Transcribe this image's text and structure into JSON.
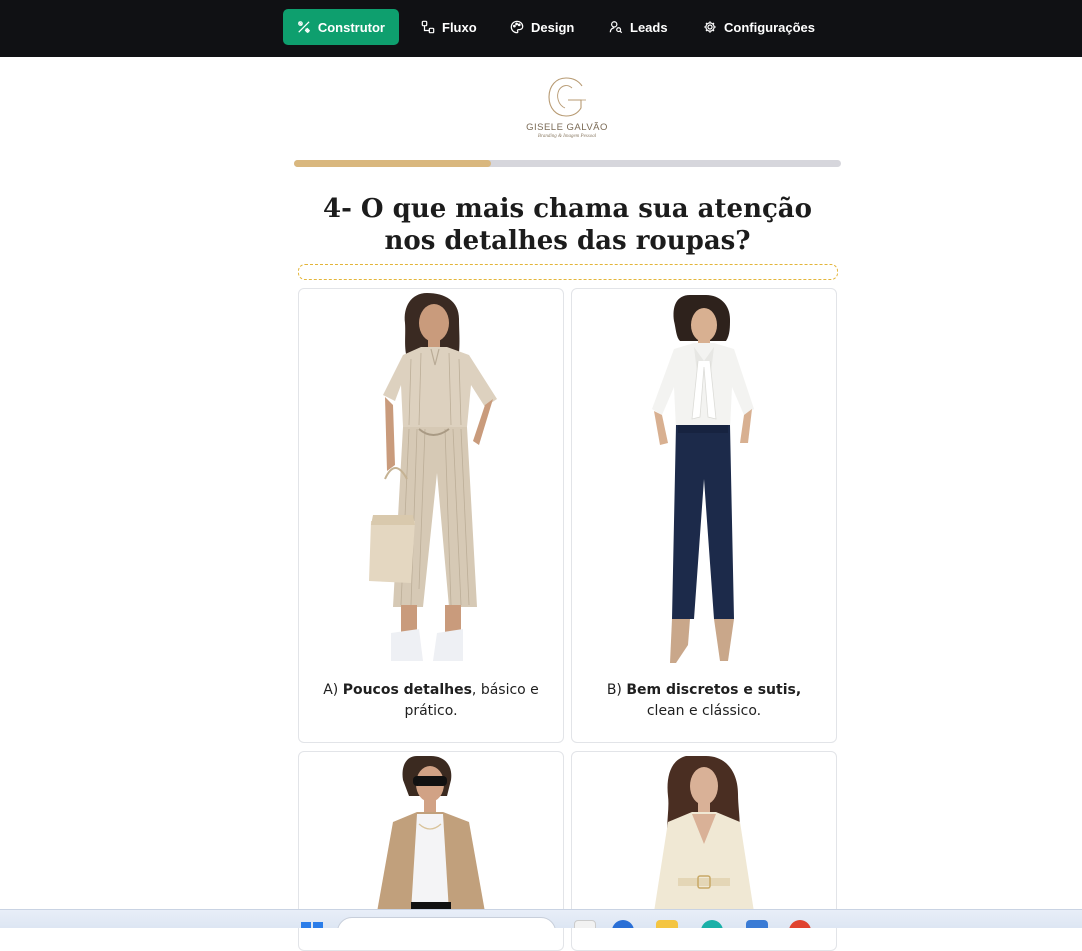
{
  "nav": {
    "items": [
      {
        "label": "Construtor",
        "icon": "tools-icon",
        "active": true
      },
      {
        "label": "Fluxo",
        "icon": "flow-icon",
        "active": false
      },
      {
        "label": "Design",
        "icon": "palette-icon",
        "active": false
      },
      {
        "label": "Leads",
        "icon": "user-search-icon",
        "active": false
      },
      {
        "label": "Configurações",
        "icon": "gear-icon",
        "active": false
      }
    ],
    "active_color": "#0e9f6e"
  },
  "brand": {
    "name": "GISELE GALVÃO",
    "tagline": "Branding & Imagem Pessoal",
    "monogram": "G"
  },
  "progress": {
    "value": 0.36,
    "fill_color": "#d9b77e"
  },
  "question": {
    "title": "4- O que mais chama sua atenção nos detalhes das roupas?"
  },
  "options": [
    {
      "letter": "A)",
      "bold": "Poucos detalhes",
      "rest": ", básico e prático.",
      "image": "striped beige jumpsuit with tote bag and white sneakers"
    },
    {
      "letter": "B)",
      "bold": "Bem discretos e sutis,",
      "rest": " clean e clássico.",
      "image": "white tie-neck blouse with navy trousers and nude heels"
    },
    {
      "letter": "",
      "bold": "",
      "rest": "",
      "image": "beige blazer with white tee and sunglasses"
    },
    {
      "letter": "",
      "bold": "",
      "rest": "",
      "image": "cream satin blouse with belt"
    }
  ],
  "taskbar": {
    "icons": [
      "windows-icon",
      "search-box",
      "file-icon",
      "edge-icon",
      "folder-icon",
      "copilot-icon",
      "store-icon",
      "chrome-icon"
    ]
  }
}
